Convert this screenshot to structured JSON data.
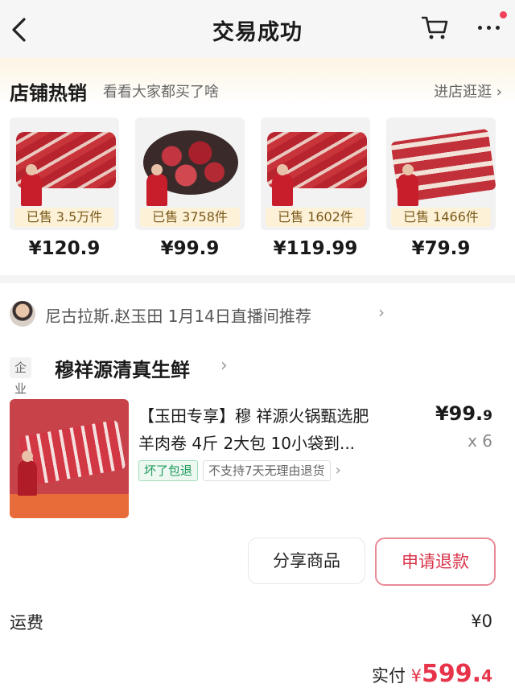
{
  "header": {
    "title": "交易成功",
    "back_icon": "chevron-left-icon",
    "cart_icon": "cart-icon",
    "more_icon": "more-dots-icon",
    "badge_color": "#f0405a"
  },
  "hot_sales": {
    "title": "店铺热销",
    "subtitle": "看看大家都买了啥",
    "link": "进店逛逛 ›",
    "items": [
      {
        "sold": "已售 3.5万件",
        "price": "¥120.9"
      },
      {
        "sold": "已售 3758件",
        "price": "¥99.9"
      },
      {
        "sold": "已售 1602件",
        "price": "¥119.99"
      },
      {
        "sold": "已售 1466件",
        "price": "¥79.9"
      }
    ]
  },
  "order": {
    "recommend_text": "尼古拉斯.赵玉田  1月14日直播间推荐",
    "recommend_arrow": "›",
    "shop_tag": "企业",
    "shop_name": "穆祥源清真生鲜",
    "shop_arrow": "›",
    "product": {
      "name_line1": "【玉田专享】穆 祥源火锅甄选肥",
      "name_line2": "羊肉卷 4斤 2大包 10小袋到...",
      "price_main": "¥99.",
      "price_dec": "9",
      "qty": "x 6",
      "badge_1": "坏了包退",
      "badge_2": "不支持7天无理由退货",
      "badge_arrow": "›"
    },
    "share_button": "分享商品",
    "refund_button": "申请退款",
    "shipping_label": "运费",
    "shipping_value": "¥0",
    "total_label": "实付",
    "total_currency": "¥",
    "total_main": "599.",
    "total_dec": "4",
    "accent_color": "#e8344a"
  }
}
